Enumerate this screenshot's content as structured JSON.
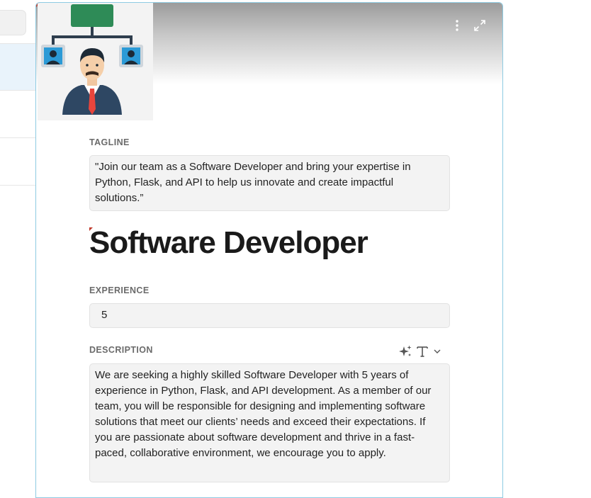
{
  "tagline": {
    "label": "TAGLINE",
    "value": "\"Join our team as a Software Developer and bring your expertise in Python, Flask, and API to help us innovate and create impactful solutions.”"
  },
  "record": {
    "title": "Software Developer"
  },
  "experience": {
    "label": "EXPERIENCE",
    "value": "5"
  },
  "description": {
    "label": "DESCRIPTION",
    "value": "We are seeking a highly skilled Software Developer with 5 years of experience in Python, Flask, and API development. As a member of our team, you will be responsible for designing and implementing software solutions that meet our clients’ needs and exceed their expectations. If you are passionate about software development and thrive in a fast-paced, collaborative environment, we encourage you to apply."
  },
  "icons": {
    "more": "more-vertical-icon",
    "expand": "expand-icon",
    "ai": "sparkles-icon",
    "format": "text-format-icon",
    "dropdown": "chevron-down-icon"
  },
  "colors": {
    "accent_border": "#8ecbe2",
    "field_bg": "#f3f3f3",
    "selected_row": "#e9f3fb"
  }
}
